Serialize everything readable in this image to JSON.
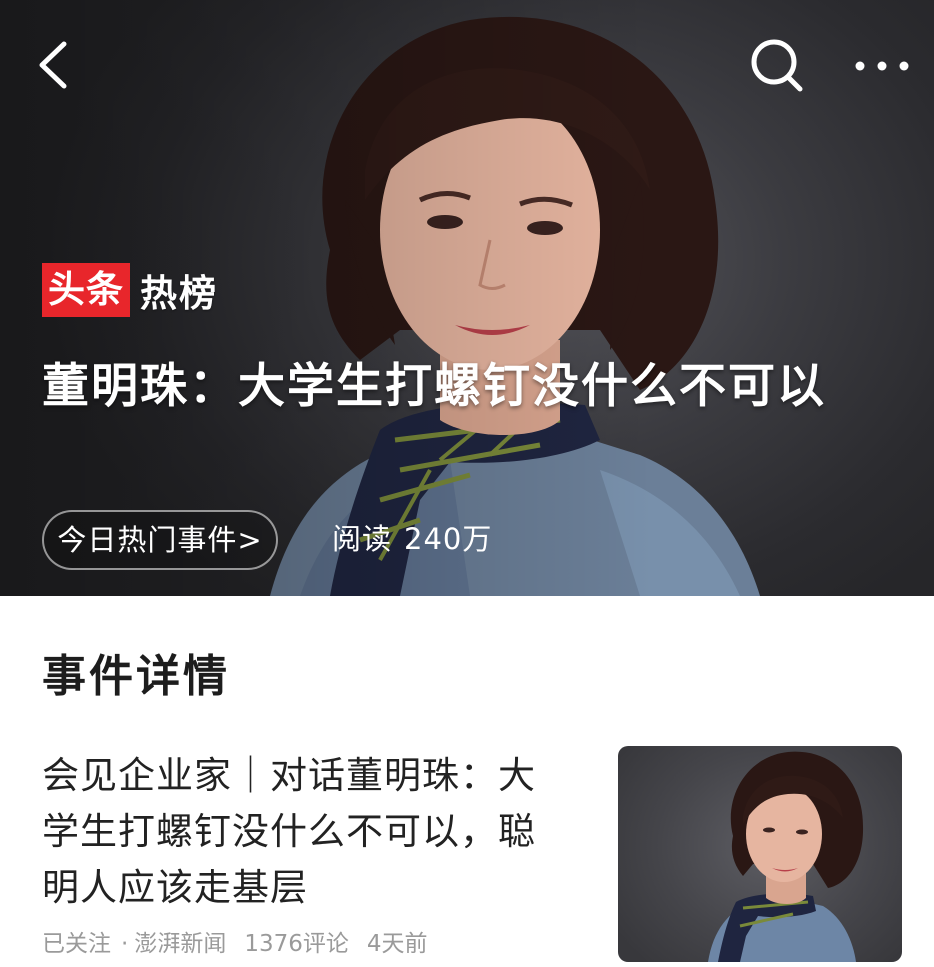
{
  "topbar": {
    "back_icon": "chevron-left-icon",
    "search_icon": "search-icon",
    "more_icon": "more-dots-icon"
  },
  "hero": {
    "brand_badge": "头条",
    "brand_text": "热榜",
    "title": "董明珠：大学生打螺钉没什么不可以",
    "chip_label": "今日热门事件>",
    "reads_label": "阅读",
    "reads_value": "240万"
  },
  "details": {
    "section_title": "事件详情",
    "card": {
      "title": "会见企业家｜对话董明珠：大学生打螺钉没什么不可以，聪明人应该走基层",
      "follow_status": "已关注",
      "separator": "·",
      "source": "澎湃新闻",
      "comments": "1376评论",
      "time": "4天前"
    }
  },
  "colors": {
    "brand_red": "#e8262b",
    "hero_bg": "#3b3b40",
    "text_primary": "#222222",
    "text_meta": "#9a9a9a"
  }
}
